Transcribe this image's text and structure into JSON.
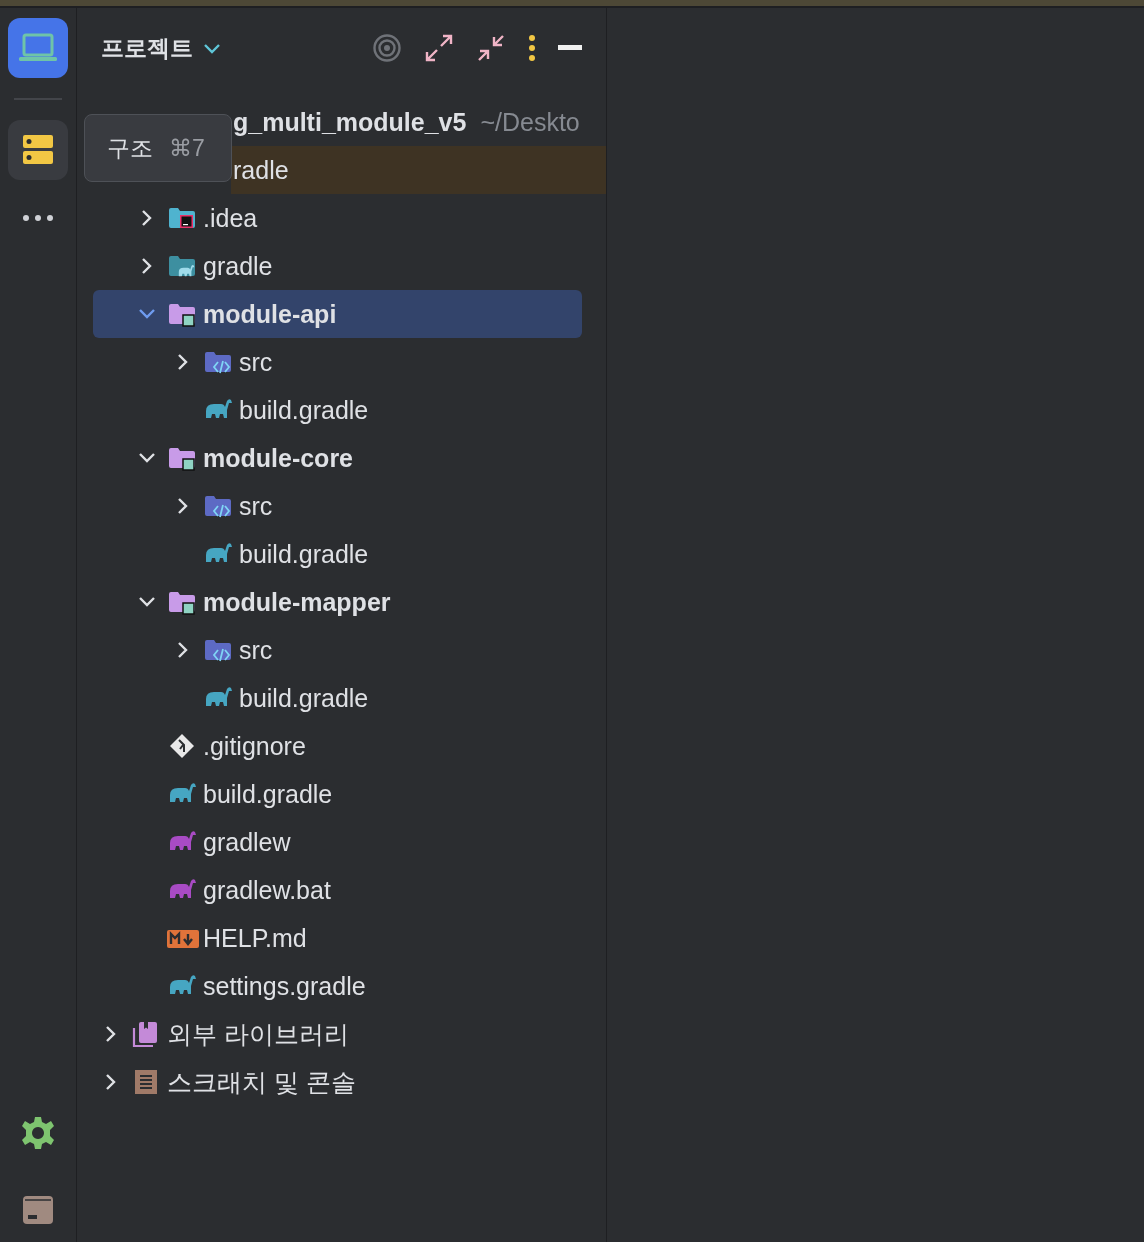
{
  "header": {
    "title": "프로젝트"
  },
  "tooltip": {
    "label": "구조",
    "shortcut": "⌘7"
  },
  "tree": [
    {
      "kind": "partial-root",
      "name": "g_multi_module_v5",
      "path": "~/Deskto",
      "selected": false,
      "highlighted": false,
      "children": [
        {
          "kind": "partial",
          "name": "radle",
          "selected": false,
          "highlighted": true
        },
        {
          "kind": "folder-idea",
          "name": ".idea",
          "expanded": false,
          "selected": false,
          "highlighted": false
        },
        {
          "kind": "folder-gradle",
          "name": "gradle",
          "expanded": false,
          "selected": false,
          "highlighted": false
        },
        {
          "kind": "module",
          "name": "module-api",
          "expanded": true,
          "selected": true,
          "highlighted": false,
          "children": [
            {
              "kind": "src",
              "name": "src",
              "expanded": false,
              "selected": false,
              "highlighted": false
            },
            {
              "kind": "gradle-file",
              "name": "build.gradle",
              "selected": false,
              "highlighted": false
            }
          ]
        },
        {
          "kind": "module",
          "name": "module-core",
          "expanded": true,
          "selected": false,
          "highlighted": false,
          "children": [
            {
              "kind": "src",
              "name": "src",
              "expanded": false,
              "selected": false,
              "highlighted": false
            },
            {
              "kind": "gradle-file",
              "name": "build.gradle",
              "selected": false,
              "highlighted": false
            }
          ]
        },
        {
          "kind": "module",
          "name": "module-mapper",
          "expanded": true,
          "selected": false,
          "highlighted": false,
          "children": [
            {
              "kind": "src",
              "name": "src",
              "expanded": false,
              "selected": false,
              "highlighted": false
            },
            {
              "kind": "gradle-file",
              "name": "build.gradle",
              "selected": false,
              "highlighted": false
            }
          ]
        },
        {
          "kind": "git",
          "name": ".gitignore",
          "selected": false,
          "highlighted": false
        },
        {
          "kind": "gradle-file",
          "name": "build.gradle",
          "selected": false,
          "highlighted": false
        },
        {
          "kind": "gradlew",
          "name": "gradlew",
          "selected": false,
          "highlighted": false
        },
        {
          "kind": "gradlew",
          "name": "gradlew.bat",
          "selected": false,
          "highlighted": false
        },
        {
          "kind": "markdown",
          "name": "HELP.md",
          "selected": false,
          "highlighted": false
        },
        {
          "kind": "gradle-file",
          "name": "settings.gradle",
          "selected": false,
          "highlighted": false
        }
      ]
    },
    {
      "kind": "library",
      "name": "외부 라이브러리",
      "expanded": false,
      "selected": false,
      "highlighted": false
    },
    {
      "kind": "scratch",
      "name": "스크래치 및 콘솔",
      "expanded": false,
      "selected": false,
      "highlighted": false
    }
  ]
}
